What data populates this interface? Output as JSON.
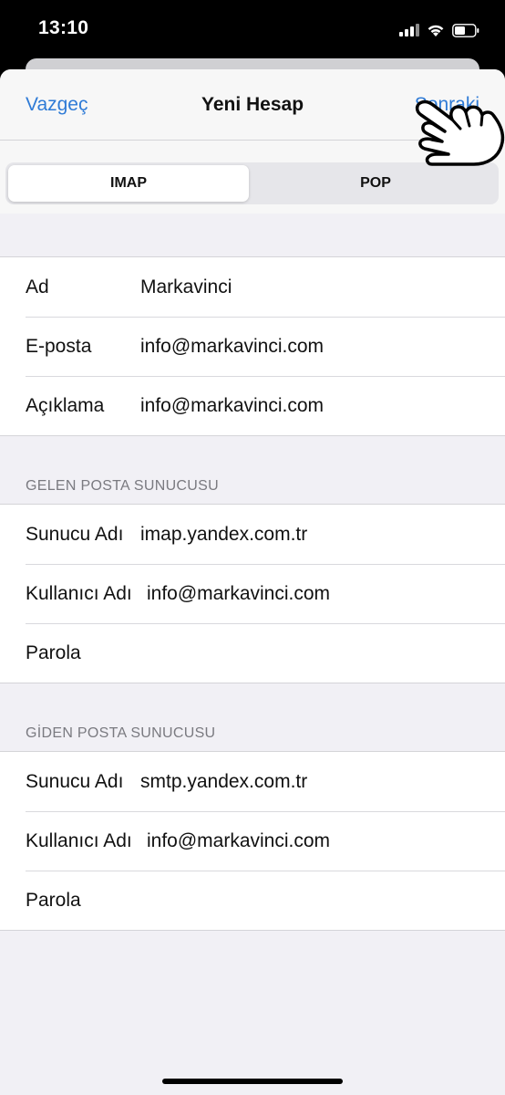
{
  "status_bar": {
    "time": "13:10",
    "icons": [
      "cellular-signal-icon",
      "wifi-icon",
      "battery-icon"
    ]
  },
  "nav": {
    "cancel_label": "Vazgeç",
    "title": "Yeni Hesap",
    "next_label": "Sonraki"
  },
  "segments": {
    "options": [
      "IMAP",
      "POP"
    ],
    "selected": "IMAP"
  },
  "account": {
    "rows": [
      {
        "label": "Ad",
        "value": "Markavinci"
      },
      {
        "label": "E-posta",
        "value": "info@markavinci.com"
      },
      {
        "label": "Açıklama",
        "value": "info@markavinci.com"
      }
    ]
  },
  "incoming": {
    "header": "GELEN POSTA SUNUCUSU",
    "rows": [
      {
        "label": "Sunucu Adı",
        "value": "imap.yandex.com.tr"
      },
      {
        "label": "Kullanıcı Adı",
        "value": "info@markavinci.com"
      },
      {
        "label": "Parola",
        "value": ""
      }
    ]
  },
  "outgoing": {
    "header": "GİDEN POSTA SUNUCUSU",
    "rows": [
      {
        "label": "Sunucu Adı",
        "value": "smtp.yandex.com.tr"
      },
      {
        "label": "Kullanıcı Adı",
        "value": "info@markavinci.com"
      },
      {
        "label": "Parola",
        "value": ""
      }
    ]
  },
  "colors": {
    "accent": "#2f7bd6",
    "background": "#f1f0f5",
    "section_header": "#7a7a80"
  },
  "overlay": {
    "icon": "pointing-hand-icon"
  }
}
